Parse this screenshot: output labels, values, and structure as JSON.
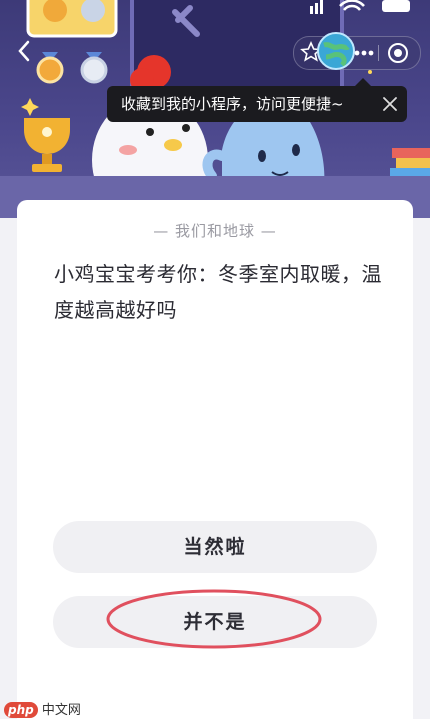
{
  "hero": {
    "illustration": "chicken-and-seal-mascots-in-classroom",
    "colors": {
      "background": "#46428a",
      "chicken_comb": "#e5352b",
      "seal": "#9ec6f0"
    }
  },
  "nav": {
    "back_icon": "chevron-left-icon",
    "capsule_icons": [
      "star-icon",
      "earth-avatar-icon",
      "more-icon",
      "target-icon"
    ]
  },
  "tooltip": {
    "text": "收藏到我的小程序，访问更便捷~",
    "close_icon": "close-icon"
  },
  "quiz": {
    "subtitle": "— 我们和地球 —",
    "question": "小鸡宝宝考考你：冬季室内取暖，温度越高越好吗",
    "options": [
      {
        "label": "当然啦"
      },
      {
        "label": "并不是",
        "annotation": "red-circle-highlight"
      }
    ],
    "colors": {
      "highlight": "#e0505e"
    }
  },
  "watermark": {
    "logo": "php",
    "text": "中文网"
  }
}
